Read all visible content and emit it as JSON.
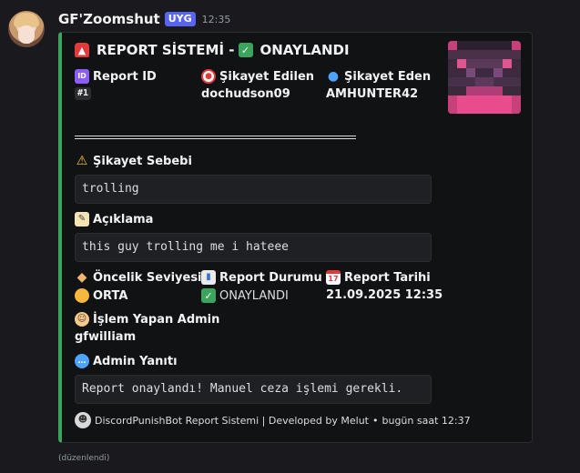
{
  "message": {
    "username": "GF'Zoomshut",
    "tag": "UYG",
    "time": "12:35",
    "edited": "(düzenlendi)"
  },
  "embed": {
    "accent_color": "#3ba55d",
    "title_prefix": "REPORT SİSTEMİ -",
    "title_status": "ONAYLANDI",
    "fields": {
      "report_id": {
        "name": "Report ID",
        "value": "#1"
      },
      "reported": {
        "name": "Şikayet Edilen",
        "value": "dochudson09"
      },
      "reporter": {
        "name": "Şikayet Eden",
        "value": "AMHUNTER42"
      },
      "reason": {
        "name": "Şikayet Sebebi",
        "value": "trolling"
      },
      "description": {
        "name": "Açıklama",
        "value": "this guy trolling me i hateee"
      },
      "priority": {
        "name": "Öncelik Seviyesi",
        "value": "ORTA"
      },
      "status": {
        "name": "Report Durumu",
        "value": "ONAYLANDI"
      },
      "date": {
        "name": "Report Tarihi",
        "value": "21.09.2025 12:35"
      },
      "admin": {
        "name": "İşlem Yapan Admin",
        "value": "gfwilliam"
      },
      "admin_reply": {
        "name": "Admin Yanıtı",
        "value": "Report onaylandı! Manuel ceza işlemi gerekli."
      }
    },
    "footer": {
      "text": "DiscordPunishBot Report Sistemi | Developed by Melut",
      "separator": "•",
      "timestamp": "bugün saat 12:37"
    }
  }
}
